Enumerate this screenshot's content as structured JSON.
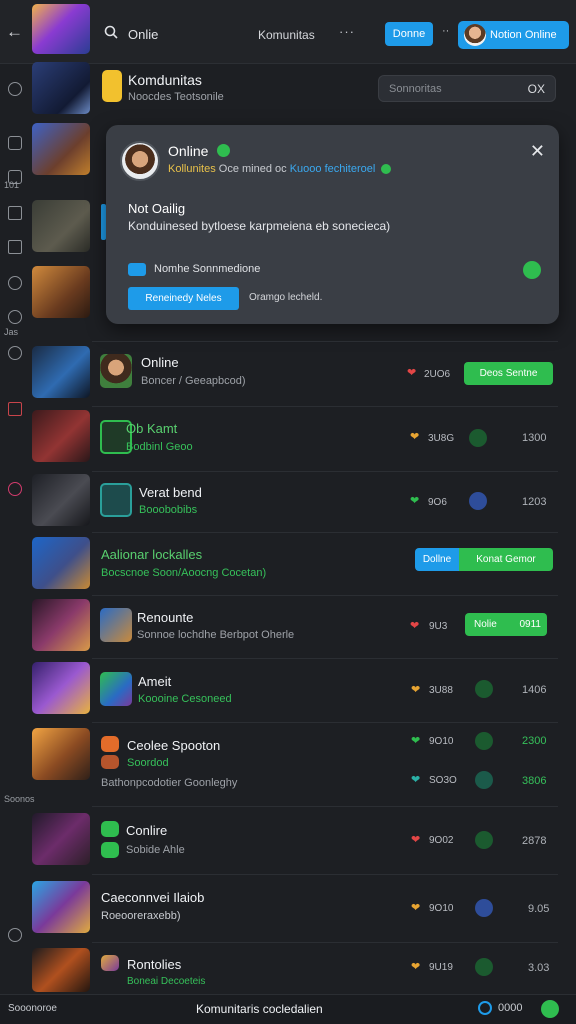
{
  "topbar": {
    "search_text": "Onlie",
    "komunitas": "Komunitas",
    "more": "···",
    "btn_small": "Donne",
    "dots": "··",
    "btn_online": "Notion Online"
  },
  "search_box": {
    "placeholder": "Sonnoritas",
    "clear": "OX"
  },
  "rail": {
    "label_a": "101",
    "label_b": "Jas",
    "label_c": "Soonos"
  },
  "popup": {
    "title": "Online",
    "sub_yellow": "Kollunites",
    "sub_mid": "Oce mined oc",
    "sub_blue": "Kuooo fechiteroel",
    "heading": "Not Oailig",
    "desc": "Konduinesed bytloese karpmeiena eb sonecieca)",
    "check_label": "Nomhe Sonnmedione",
    "button": "Reneinedy Neles",
    "change": "Oramgo lecheld."
  },
  "rows": [
    {
      "title": "Komdunitas",
      "sub": "Noocdes Teotsonile"
    },
    {
      "title": "Online",
      "sub": "Boncer / Geeapbcod)",
      "count": "2UO6",
      "pill": "Deos Sentne"
    },
    {
      "title": "Ob Kamt",
      "sub": "Bodbinl Geoo",
      "count": "3U8G",
      "num": "1300"
    },
    {
      "title": "Verat bend",
      "sub": "Booobobibs",
      "count": "9O6",
      "num": "1203"
    },
    {
      "title": "Aalionar lockalles",
      "sub": "Bocscnoe Soon/Aoocng Cocetan)",
      "pill_a": "Dollne",
      "pill_b": "Konat Gemor"
    },
    {
      "title": "Renounte",
      "sub": "Sonnoe lochdhe Berbpot Oherle",
      "count": "9U3",
      "pill": "Nolie",
      "pill_num": "0911"
    },
    {
      "title": "Ameit",
      "sub": "Koooine Cesoneed",
      "count": "3U88",
      "num": "1406"
    },
    {
      "title": "Ceolee Spooton",
      "sub": "Soordod",
      "sub2": "Bathonpcodotier Goonleghy",
      "count": "9O10",
      "num": "2300",
      "count2": "SO3O",
      "num2": "3806"
    },
    {
      "title": "Conlire",
      "sub": "Sobide Ahle",
      "count": "9O02",
      "num": "2878"
    },
    {
      "title": "Caeconnvei Ilaiob",
      "sub": "Roeooreraxebb)",
      "count": "9O10",
      "num": "9.05"
    },
    {
      "title": "Rontolies",
      "sub": "Boneai Decoeteis",
      "count": "9U19",
      "num": "3.03"
    }
  ],
  "bottombar": {
    "left": "Sooonoroe",
    "center": "Komunitaris cocledalien",
    "right": "0000"
  },
  "colors": {
    "accent_blue": "#1e9be9",
    "accent_green": "#2fbd4f",
    "bg": "#1d1f23"
  }
}
